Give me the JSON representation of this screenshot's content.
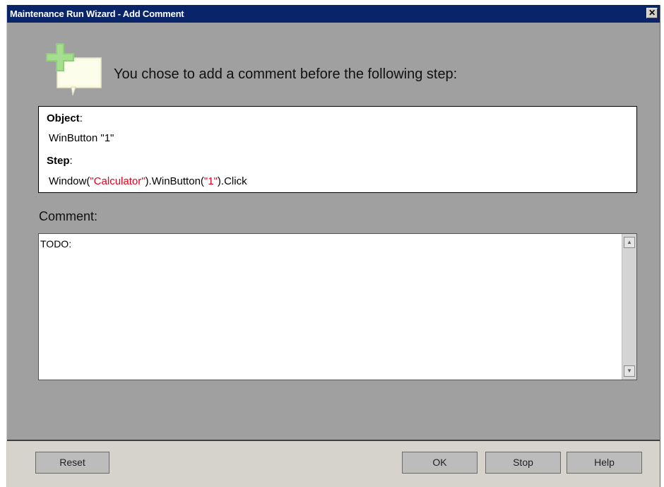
{
  "window": {
    "title": "Maintenance Run Wizard - Add Comment",
    "close_glyph": "✕"
  },
  "header": {
    "icon": "add-comment-icon",
    "text": "You chose to add a comment before the following step:"
  },
  "step_info": {
    "object_label": "Object",
    "object_colon": ":",
    "object_value": "WinButton \"1\"",
    "step_label": "Step",
    "step_colon": ":",
    "step_parts": {
      "p1": "Window(",
      "s1": "\"Calculator\"",
      "p2": ").WinButton(",
      "s2": "\"1\"",
      "p3": ").Click"
    }
  },
  "comment": {
    "label": "Comment:",
    "value": "TODO:"
  },
  "footer": {
    "reset_label": "Reset",
    "ok_label": "OK",
    "stop_label": "Stop",
    "help_label": "Help"
  },
  "colors": {
    "titlebar": "#0a246a",
    "body_bg": "#a0a0a0",
    "footer_bg": "#d6d3cc",
    "string_literal": "#e8001c"
  }
}
